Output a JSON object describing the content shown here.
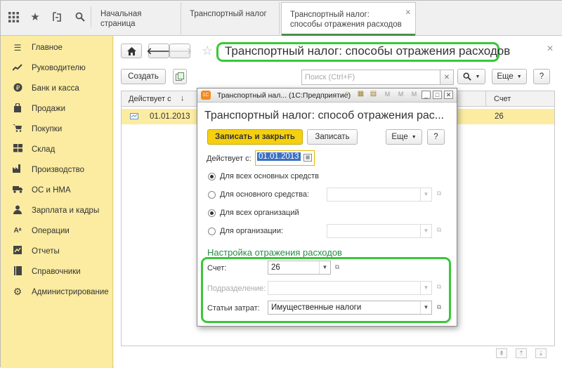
{
  "topbar": {
    "icons": [
      "apps-grid-icon",
      "star-icon",
      "history-icon",
      "search-icon"
    ],
    "tabs": [
      {
        "label": "Начальная страница"
      },
      {
        "label": "Транспортный налог"
      },
      {
        "label": "Транспортный налог: способы отражения расходов"
      }
    ]
  },
  "sidebar": {
    "items": [
      {
        "label": "Главное",
        "icon": "menu-lines-icon"
      },
      {
        "label": "Руководителю",
        "icon": "trend-chart-icon"
      },
      {
        "label": "Банк и касса",
        "icon": "ruble-coin-icon"
      },
      {
        "label": "Продажи",
        "icon": "shopping-bag-icon"
      },
      {
        "label": "Покупки",
        "icon": "shopping-cart-icon"
      },
      {
        "label": "Склад",
        "icon": "warehouse-icon"
      },
      {
        "label": "Производство",
        "icon": "factory-icon"
      },
      {
        "label": "ОС и НМА",
        "icon": "truck-icon"
      },
      {
        "label": "Зарплата и кадры",
        "icon": "person-icon"
      },
      {
        "label": "Операции",
        "icon": "operations-icon"
      },
      {
        "label": "Отчеты",
        "icon": "report-chart-icon"
      },
      {
        "label": "Справочники",
        "icon": "book-icon"
      },
      {
        "label": "Администрирование",
        "icon": "gear-icon"
      }
    ]
  },
  "content": {
    "title": "Транспортный налог: способы отражения расходов",
    "create_label": "Создать",
    "search_placeholder": "Поиск (Ctrl+F)",
    "more_label": "Еще",
    "help_label": "?",
    "columns": {
      "date": "Действует с",
      "account": "Счет"
    },
    "rows": [
      {
        "date": "01.01.2013",
        "account": "26"
      }
    ]
  },
  "dialog": {
    "window_title": "Транспортный нал... (1С:Предприятие)",
    "heading": "Транспортный налог: способ отражения рас...",
    "save_close_label": "Записать и закрыть",
    "save_label": "Записать",
    "more_label": "Еще",
    "help_label": "?",
    "effective_label": "Действует с:",
    "effective_value": "01.01.2013",
    "radio_all_assets": "Для всех основных средств",
    "radio_one_asset": "Для основного средства:",
    "radio_all_orgs": "Для всех организаций",
    "radio_one_org": "Для организации:",
    "section_title": "Настройка отражения расходов",
    "account_label": "Счет:",
    "account_value": "26",
    "department_label": "Подразделение:",
    "expense_label": "Статьи затрат:",
    "expense_value": "Имущественные налоги"
  },
  "colors": {
    "accent_green": "#38c838",
    "sidebar_bg": "#fbeca1",
    "primary_button": "#f5d010",
    "selected_value_bg": "#3a6fc4"
  }
}
